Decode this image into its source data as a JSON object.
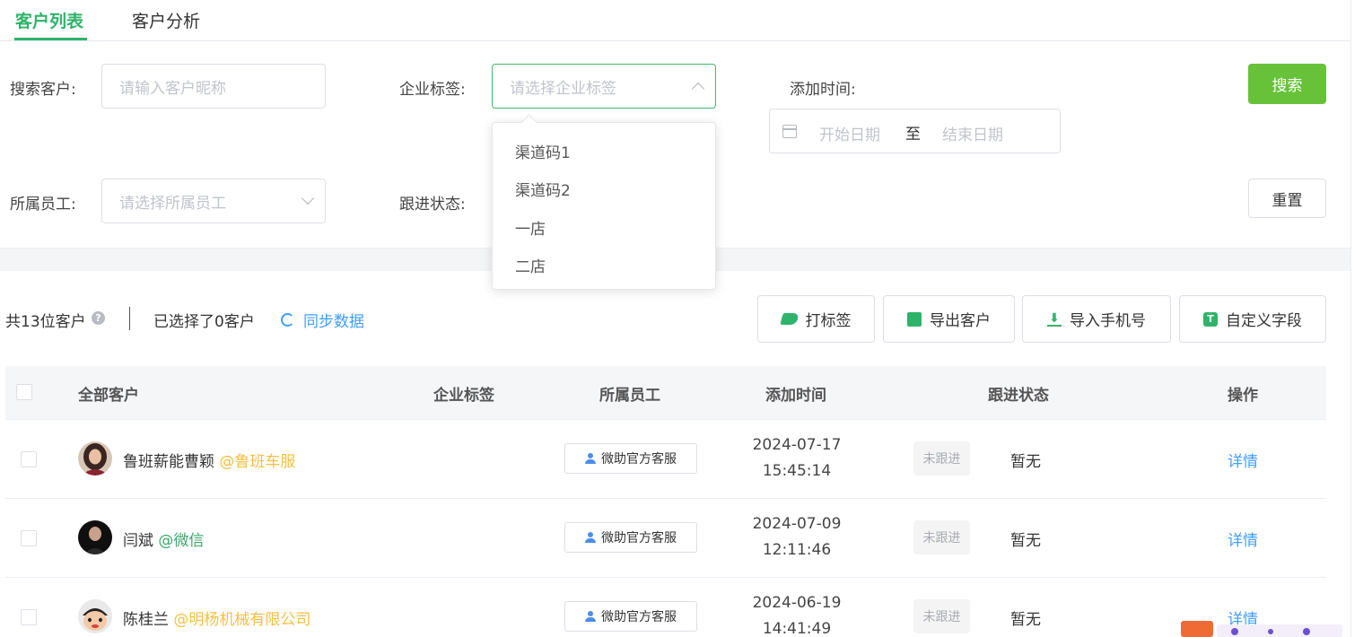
{
  "tabs": [
    {
      "label": "客户列表",
      "active": true
    },
    {
      "label": "客户分析",
      "active": false
    }
  ],
  "filters": {
    "search_label": "搜索客户:",
    "search_placeholder": "请输入客户昵称",
    "tag_label": "企业标签:",
    "tag_placeholder": "请选择企业标签",
    "time_label": "添加时间:",
    "start_placeholder": "开始日期",
    "range_separator": "至",
    "end_placeholder": "结束日期",
    "staff_label": "所属员工:",
    "staff_placeholder": "请选择所属员工",
    "follow_label": "跟进状态:",
    "search_button": "搜索",
    "reset_button": "重置"
  },
  "tag_dropdown": {
    "options": [
      "渠道码1",
      "渠道码2",
      "一店",
      "二店"
    ]
  },
  "toolbar": {
    "total": "共13位客户",
    "help_glyph": "?",
    "selected": "已选择了0客户",
    "sync": "同步数据",
    "buttons": {
      "tag": "打标签",
      "export": "导出客户",
      "import": "导入手机号",
      "custom": "自定义字段"
    },
    "icon_glyphs": {
      "import": "⬇",
      "custom": "T"
    }
  },
  "table": {
    "headers": {
      "all": "全部客户",
      "tags": "企业标签",
      "staff": "所属员工",
      "time": "添加时间",
      "status": "跟进状态",
      "ops": "操作"
    },
    "rows": [
      {
        "name": "鲁班薪能曹颖",
        "corp": "@鲁班车服",
        "staff": "微助官方客服",
        "time": "2024-07-17 15:45:14",
        "follow": "未跟进",
        "status": "暂无",
        "action": "详情"
      },
      {
        "name": "闫斌",
        "corp": "@微信",
        "staff": "微助官方客服",
        "time": "2024-07-09 12:11:46",
        "follow": "未跟进",
        "status": "暂无",
        "action": "详情"
      },
      {
        "name": "陈桂兰",
        "corp": "@明杨机械有限公司",
        "staff": "微助官方客服",
        "time": "2024-06-19 14:41:49",
        "follow": "未跟进",
        "status": "暂无",
        "action": "详情"
      }
    ]
  },
  "colors": {
    "brand_green": "#2fb36a",
    "search_button": "#67c23a",
    "link_blue": "#409eff",
    "corp_yellow": "#f5c042",
    "corp_green": "#3aa66b"
  }
}
